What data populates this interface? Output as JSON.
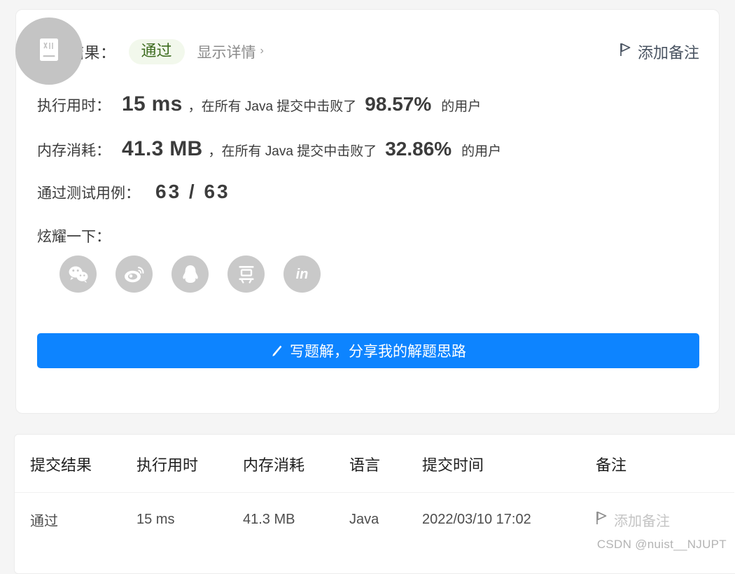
{
  "result_panel": {
    "result_label": "执行结果：",
    "status_badge": "通过",
    "detail_link": "显示详情",
    "detail_chevron": "›",
    "add_note_label": "添加备注",
    "runtime": {
      "key": "执行用时：",
      "value": "15 ms",
      "comma": "，",
      "middle": "在所有 Java 提交中击败了",
      "percent": "98.57%",
      "tail": "的用户"
    },
    "memory": {
      "key": "内存消耗：",
      "value": "41.3 MB",
      "comma": "，",
      "middle": "在所有 Java 提交中击败了",
      "percent": "32.86%",
      "tail": "的用户"
    },
    "testcases": {
      "key": "通过测试用例：",
      "value": "63 / 63"
    },
    "share": {
      "label": "炫耀一下：",
      "icons": [
        {
          "name": "wechat-icon",
          "glyph": ""
        },
        {
          "name": "weibo-icon",
          "glyph": ""
        },
        {
          "name": "qq-icon",
          "glyph": ""
        },
        {
          "name": "douban-icon",
          "glyph": "豆"
        },
        {
          "name": "linkedin-icon",
          "glyph": "in"
        }
      ]
    },
    "solution_button": "写题解，分享我的解题思路"
  },
  "submissions_table": {
    "headers": [
      "提交结果",
      "执行用时",
      "内存消耗",
      "语言",
      "提交时间",
      "备注"
    ],
    "rows": [
      {
        "result": "通过",
        "runtime": "15 ms",
        "memory": "41.3 MB",
        "language": "Java",
        "submitted_at": "2022/03/10 17:02",
        "note": "添加备注"
      }
    ]
  },
  "watermark": "CSDN @nuist__NJUPT",
  "colors": {
    "accent_blue": "#0d84ff",
    "pass_green": "#4caf50",
    "badge_green_text": "#3d6c1f",
    "badge_green_bg": "#f2f8ec",
    "page_bg": "#f5f5f5",
    "overlay_gray": "#c4c4c4"
  }
}
